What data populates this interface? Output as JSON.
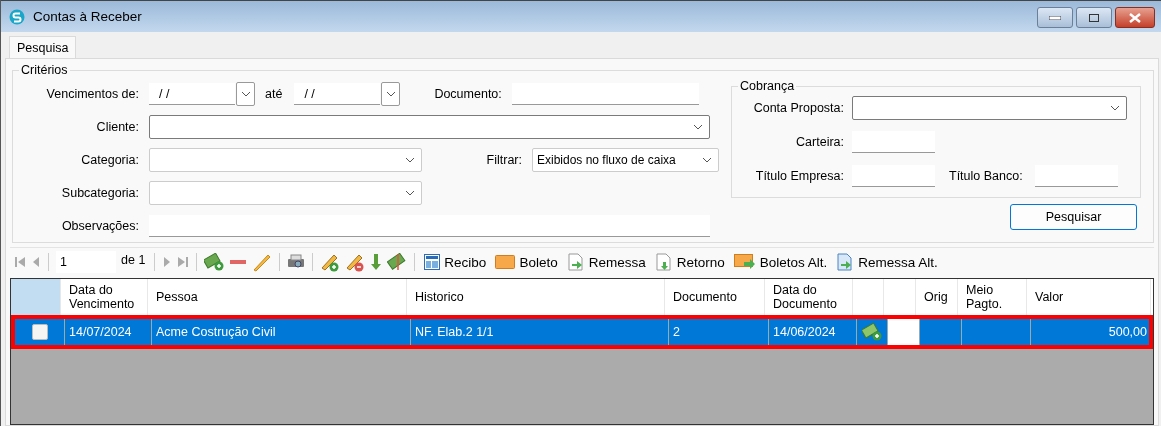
{
  "window": {
    "title": "Contas à Receber"
  },
  "tabs": [
    {
      "label": "Pesquisa",
      "selected": true
    }
  ],
  "criteria": {
    "title": "Critérios",
    "due_from": {
      "label": "Vencimentos de:",
      "value": "/ /"
    },
    "due_to": {
      "label": "até",
      "value": "/ /"
    },
    "document": {
      "label": "Documento:"
    },
    "client": {
      "label": "Cliente:"
    },
    "category": {
      "label": "Categoria:"
    },
    "filter": {
      "label": "Filtrar:",
      "value": "Exibidos no fluxo de caixa"
    },
    "subcategory": {
      "label": "Subcategoria:"
    },
    "notes": {
      "label": "Observações:"
    },
    "billing": {
      "title": "Cobrança",
      "account": {
        "label": "Conta Proposta:"
      },
      "wallet": {
        "label": "Carteira:"
      },
      "company_title": {
        "label": "Título Empresa:"
      },
      "bank_title": {
        "label": "Título Banco:"
      }
    },
    "search_button": "Pesquisar"
  },
  "navigator": {
    "page": "1",
    "of": "de 1"
  },
  "toolbar_buttons": [
    {
      "label": "Recibo",
      "kind": "receipt"
    },
    {
      "label": "Boleto",
      "kind": "slip"
    },
    {
      "label": "Remessa",
      "kind": "send"
    },
    {
      "label": "Retorno",
      "kind": "return"
    },
    {
      "label": "Boletos Alt.",
      "kind": "slips"
    },
    {
      "label": "Remessa Alt.",
      "kind": "send2"
    }
  ],
  "table": {
    "columns": [
      "",
      "Data do Vencimento",
      "Pessoa",
      "Historico",
      "Documento",
      "Data do Documento",
      "",
      "",
      "Orig",
      "Meio Pagto.",
      "Valor"
    ],
    "rows": [
      {
        "checked": false,
        "selected": true,
        "highlighted": true,
        "due": "14/07/2024",
        "person": "Acme Costrução Civil",
        "history": "NF. Elab.2 1/1",
        "document": "2",
        "doc_date": "14/06/2024",
        "orig": "",
        "value": "500,00"
      }
    ]
  }
}
